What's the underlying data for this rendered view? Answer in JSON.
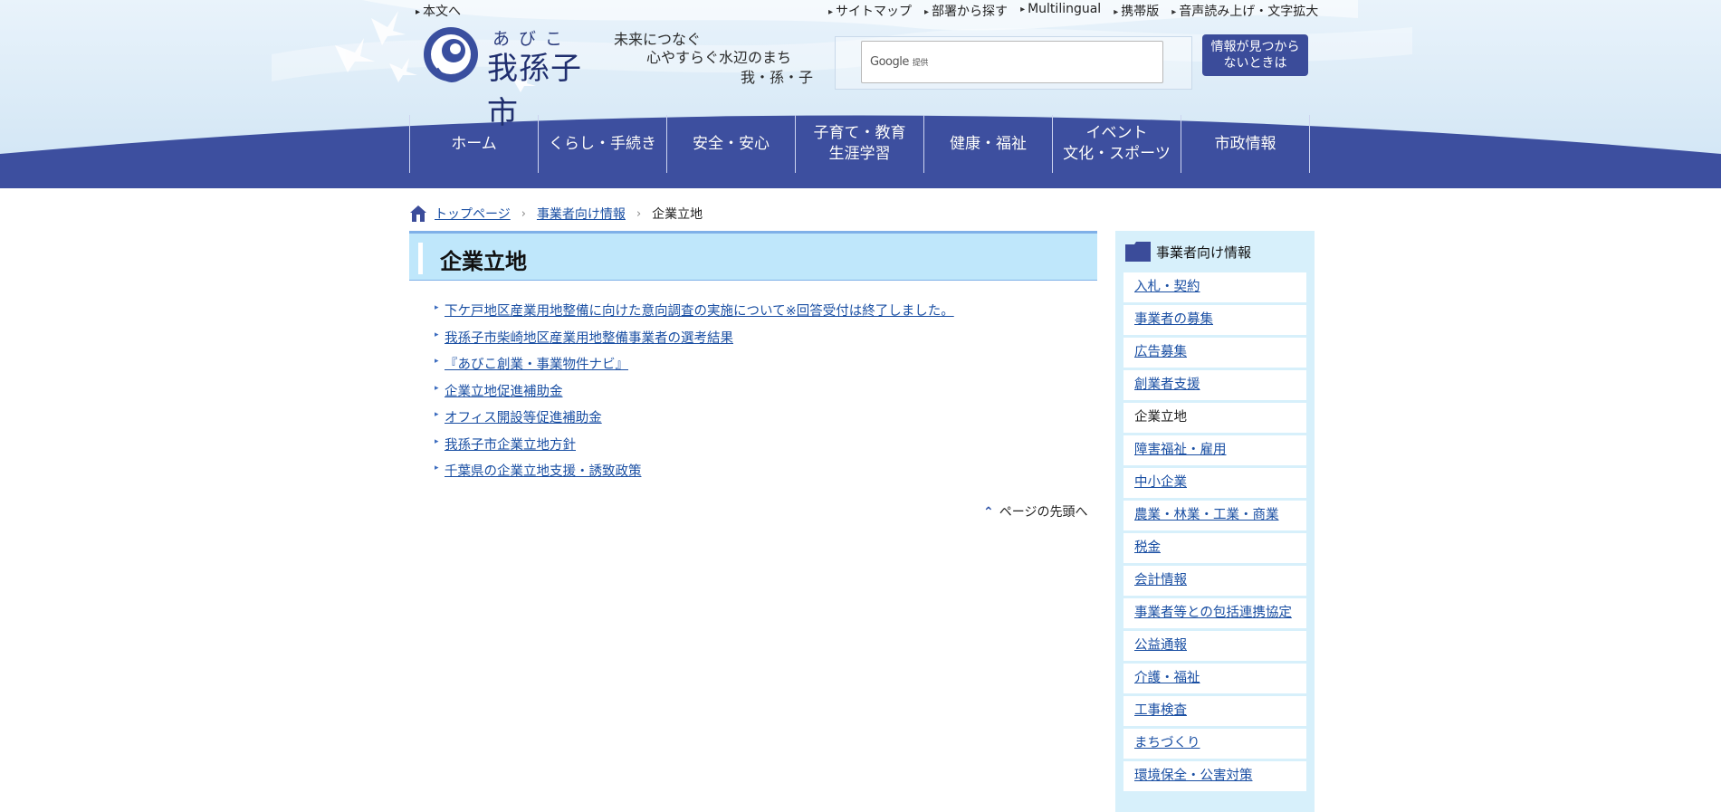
{
  "header": {
    "skip_link": "本文へ",
    "utility_links": [
      "サイトマップ",
      "部署から探す",
      "Multilingual",
      "携帯版",
      "音声読み上げ・文字拡大"
    ],
    "logo_kana": "あびこ",
    "logo_name": "我孫子市",
    "tagline": [
      "未来につなぐ",
      "心やすらぐ水辺のまち",
      "我・孫・子"
    ],
    "search": {
      "brand": "Google",
      "brand_suffix": "提供",
      "value": ""
    },
    "help_button": "情報が見つから\nないときは"
  },
  "global_nav": [
    "ホーム",
    "くらし・手続き",
    "安全・安心",
    "子育て・教育\n生涯学習",
    "健康・福祉",
    "イベント\n文化・スポーツ",
    "市政情報"
  ],
  "breadcrumb": {
    "items": [
      "トップページ",
      "事業者向け情報"
    ],
    "current": "企業立地"
  },
  "main": {
    "title": "企業立地",
    "links": [
      "下ケ戸地区産業用地整備に向けた意向調査の実施について※回答受付は終了しました。",
      "我孫子市柴崎地区産業用地整備事業者の選考結果",
      "『あびこ創業・事業物件ナビ』",
      "企業立地促進補助金",
      "オフィス開設等促進補助金",
      "我孫子市企業立地方針",
      "千葉県の企業立地支援・誘致政策"
    ],
    "page_top": "ページの先頭へ"
  },
  "sidebar": {
    "title": "事業者向け情報",
    "items": [
      "入札・契約",
      "事業者の募集",
      "広告募集",
      "創業者支援",
      "企業立地",
      "障害福祉・雇用",
      "中小企業",
      "農業・林業・工業・商業",
      "税金",
      "会計情報",
      "事業者等との包括連携協定",
      "公益通報",
      "介護・福祉",
      "工事検査",
      "まちづくり",
      "環境保全・公害対策"
    ],
    "current_index": 4
  },
  "colors": {
    "nav_blue": "#3b4c9a",
    "title_bg": "#bfe7fb",
    "sidebar_bg": "#d7f0fb",
    "link": "#1a4fa3"
  }
}
